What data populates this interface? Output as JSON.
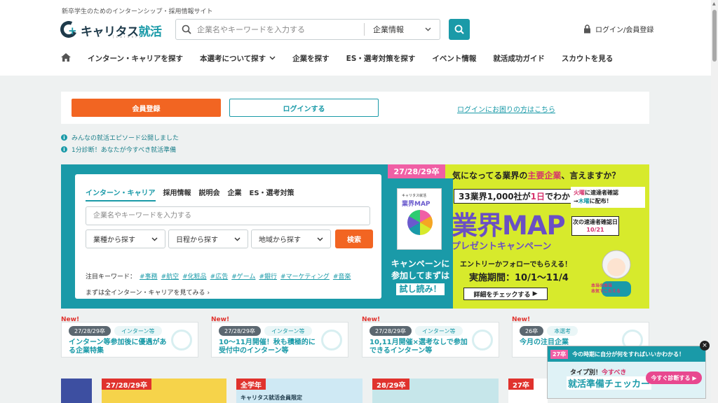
{
  "header": {
    "tagline": "新卒学生のためのインターンシップ・採用情報サイト",
    "logo_text": "キャリタス",
    "logo_text_accent": "就活",
    "logo_sub": "[ c a r e e r ]",
    "search_placeholder": "企業名やキーワードを入力する",
    "search_select": "企業情報",
    "login_label": "ログイン/会員登録"
  },
  "nav": {
    "items": [
      {
        "label": "インターン・キャリアを探す",
        "dropdown": false
      },
      {
        "label": "本選考について探す",
        "dropdown": true
      },
      {
        "label": "企業を探す",
        "dropdown": false
      },
      {
        "label": "ES・選考対策を探す",
        "dropdown": false
      },
      {
        "label": "イベント情報",
        "dropdown": false
      },
      {
        "label": "就活成功ガイド",
        "dropdown": false
      },
      {
        "label": "スカウトを見る",
        "dropdown": false
      }
    ]
  },
  "member": {
    "register_label": "会員登録",
    "login_label": "ログインする",
    "help_label": "ログインにお困りの方はこちら"
  },
  "notices": [
    "みんなの就活エピソード公開しました",
    "1分診断！あなたが今すべき就活準備"
  ],
  "hero": {
    "tabs": [
      "インターン・キャリア",
      "採用情報",
      "説明会",
      "企業",
      "ES・選考対策"
    ],
    "active_tab": 0,
    "input_placeholder": "企業名やキーワードを入力する",
    "filters": [
      "業種から探す",
      "日程から探す",
      "地域から探す"
    ],
    "search_label": "検索",
    "keywords_label": "注目キーワード：",
    "keywords": [
      "#事務",
      "#航空",
      "#化粧品",
      "#広告",
      "#ゲーム",
      "#銀行",
      "#マーケティング",
      "#音楽"
    ],
    "see_all": "まずは全インターン・キャリアを見てみる"
  },
  "banner": {
    "year_tag": "27/28/29卒",
    "headline_pre": "気になってる業界の",
    "headline_accent": "主要企業",
    "headline_post": "、言えますか？",
    "count_pre": "33業界1,000社が",
    "count_accent": "1日",
    "count_post": "でわかる！",
    "map_title": "業界MAP",
    "campaign": "プレゼントキャンペーン",
    "entry": "エントリーかフォローでもらえる！",
    "period": "実施期間：10/1～11/4",
    "detail_btn": "詳細をチェックする",
    "side_line1": "キャンペーンに",
    "side_line2": "参加してまずは",
    "side_read": "試し読み！",
    "book_t1": "キャリタス就活",
    "book_t2": "業界MAP",
    "tag_line1_a": "火曜",
    "tag_line1_b": "に速達者確認",
    "tag_line2_a": "木曜",
    "tag_line2_b": "に配布！",
    "date_label": "次の速達者確認日",
    "date_value": "10/21",
    "caption_line1": "本当の本当",
    "caption_line2": "本気でこたえる"
  },
  "cards": [
    {
      "new": "New!",
      "year": "27/28/29卒",
      "type": "インターン等",
      "title": "インターン等参加後に優遇がある企業特集"
    },
    {
      "new": "New!",
      "year": "27/28/29卒",
      "type": "インターン等",
      "title": "10～11月開催！秋も積極的に受付中のインターン等"
    },
    {
      "new": "New!",
      "year": "27/28/29卒",
      "type": "インターン等",
      "title": "10,11月開催×選考なしで参加できるインターン等"
    },
    {
      "new": "New!",
      "year": "26卒",
      "type": "本選考",
      "title": "今月の注目企業"
    }
  ],
  "peek": [
    {
      "label": "",
      "color": "#3d4fa1"
    },
    {
      "label": "27/28/29卒",
      "color": "#e0322d"
    },
    {
      "label": "全学年",
      "color": "#e0322d"
    },
    {
      "label": "28/29卒",
      "color": "#e0322d"
    },
    {
      "label": "27卒",
      "color": "#e0322d"
    }
  ],
  "peek_texts": {
    "member_only": "キャリタス就活会員限定"
  },
  "popup": {
    "year": "27卒",
    "bar_text": "今の時期に自分が何をすればいいかわかる！",
    "line1_pre": "タイプ別！",
    "line1_accent": "今すべき",
    "line2": "就活準備チェッカー",
    "cta": "今すぐ診断する ▶",
    "close": "×"
  }
}
